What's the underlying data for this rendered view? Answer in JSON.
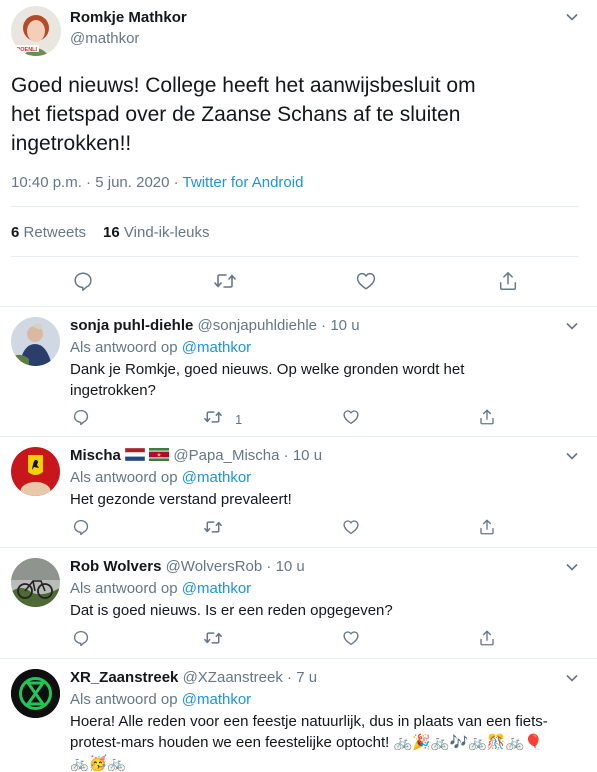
{
  "tweet": {
    "author_name": "Romkje Mathkor",
    "author_handle": "@mathkor",
    "text_lines": [
      "Goed nieuws! College heeft het aanwijsbesluit om",
      "het fietspad over de Zaanse Schans af te sluiten",
      "ingetrokken!!"
    ],
    "time": "10:40 p.m.",
    "dot": " · ",
    "date": "5 jun. 2020",
    "source": "Twitter for Android",
    "retweets_count": "6",
    "retweets_label": "Retweets",
    "likes_count": "16",
    "likes_label": "Vind-ik-leuks",
    "avatar_badge": "GROENLINKS"
  },
  "reply_prefix": "Als antwoord op",
  "reply_to": "@mathkor",
  "replies": [
    {
      "name": "sonja puhl-diehle",
      "handle": "@sonjapuhldiehle",
      "time": "10 u",
      "text_lines": [
        "Dank je Romkje,  goed nieuws.  Op welke gronden wordt het",
        "ingetrokken?"
      ],
      "retweet_count": "1"
    },
    {
      "name": "Mischa",
      "handle": "@Papa_Mischa",
      "time": "10 u",
      "text_lines": [
        "Het gezonde verstand prevaleert!"
      ],
      "retweet_count": ""
    },
    {
      "name": "Rob Wolvers",
      "handle": "@WolversRob",
      "time": "10 u",
      "text_lines": [
        "Dat is goed nieuws. Is er een reden opgegeven?"
      ],
      "retweet_count": ""
    },
    {
      "name": "XR_Zaanstreek",
      "handle": "@XZaanstreek",
      "time": "7 u",
      "text_lines": [
        "Hoera! Alle reden voor een feestje natuurlijk, dus in plaats van een fiets-",
        "protest-mars houden we een feestelijke optocht! 🚲🎉🚲🎶🚲🎊🚲🎈",
        "🚲🥳🚲"
      ],
      "retweet_count": ""
    }
  ],
  "icons": {
    "reply": "reply-icon",
    "retweet": "retweet-icon",
    "like": "heart-icon",
    "share": "share-icon",
    "menu": "chevron-down-icon"
  },
  "colors": {
    "link": "#1b95e0",
    "muted": "#657786",
    "text": "#14171a",
    "border": "#e6ecf0"
  }
}
